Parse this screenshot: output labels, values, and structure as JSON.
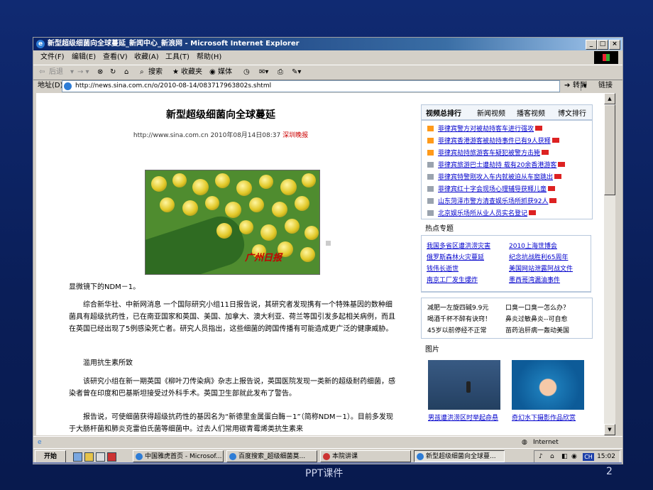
{
  "window": {
    "title": "新型超级细菌向全球蔓延_新闻中心_新浪网 - Microsoft Internet Explorer",
    "min_label": "_",
    "max_label": "□",
    "close_label": "×"
  },
  "menu": [
    "文件(F)",
    "编辑(E)",
    "查看(V)",
    "收藏(A)",
    "工具(T)",
    "帮助(H)"
  ],
  "toolbar": {
    "back": "后退",
    "search": "搜索",
    "favorites": "收藏夹",
    "media": "媒体"
  },
  "address": {
    "label": "地址(D)",
    "url": "http://news.sina.com.cn/o/2010-08-14/083717963802s.shtml",
    "go": "转到",
    "links": "链接"
  },
  "article": {
    "headline": "新型超级细菌向全球蔓延",
    "byline_main": "http://www.sina.com.cn  2010年08月14日08:37",
    "byline_source": "深圳晚报",
    "photo_watermark": "广州日报",
    "caption": "显微镜下的NDM－1。",
    "paragraphs": [
      "综合新华社、中新网消息 一个国际研究小组11日报告说，其研究者发现携有一个特殊基因的数种细菌具有超级抗药性，已在南亚国家和英国、美国、加拿大、澳大利亚、荷兰等国引发多起相关病例，而且在英国已经出现了5例感染死亡者。研究人员指出，这些细菌的跨国传播有可能造成更广泛的健康威胁。",
      "滥用抗生素所致",
      "该研究小组在新一期英国《柳叶刀传染病》杂志上报告说，英国医院发现一类新的超级耐药细菌，感染者曾在印度和巴基斯坦接受过外科手术。英国卫生部就此发布了警告。",
      "报告说，可使细菌获得超级抗药性的基因名为“新德里金属蛋白酶－1”（简称NDM－1）。目前多发现于大肠杆菌和肺炎克雷伯氏菌等细菌中。过去人们常用碳青霉烯类抗生素来"
    ]
  },
  "sidebar": {
    "tabs": [
      "视频总排行",
      "新闻视频",
      "播客视频",
      "博文排行"
    ],
    "rank": [
      "菲律宾警方对被劫持客车进行强攻",
      "菲律宾香港游客被劫持事件已有9人获释",
      "菲律宾劫持旅游客车疑犯被警方击毙",
      "菲律宾旅游巴士遭劫持 载有20余香港游客",
      "菲律宾特警刚攻入车内就被迫从车窗跳出",
      "菲律宾红十字会现场心理辅导获释儿童",
      "山东菏泽市警方清查娱乐场所抓获92人",
      "北京娱乐场所从业人员实名登记"
    ],
    "hot_title": "热点专题",
    "hot_left": [
      "我国多省区遭洪涝灾害",
      "俄罗斯森林火灾蔓延",
      "钱伟长逝世",
      "南京工厂发生爆炸"
    ],
    "hot_right": [
      "2010上海世博会",
      "纪念抗战胜利65周年",
      "美国网站泄露阿战文件",
      "墨西哥湾漏油事件"
    ],
    "ads": [
      [
        "减肥一左旋四碱9.9元",
        "口臭一口臭一怎么办？"
      ],
      [
        "喝酒千杯不醉有诀窍！",
        "鼻炎过敏鼻炎--可自愈"
      ],
      [
        "45岁以前停经不正常",
        "苗药治肝病一轰动美国"
      ]
    ],
    "photos_title": "图片",
    "photo_captions": [
      "男孩遭洪涝区时举起命悬",
      "奇幻水下摄影作品欣赏"
    ]
  },
  "status": {
    "zone": "Internet"
  },
  "taskbar": {
    "start": "开始",
    "tasks": [
      "中国雅虎首页 - Microsof...",
      "百度搜索_超级细菌莫...",
      "本院讲课",
      "新型超级细菌向全球蔓..."
    ],
    "lang": "CH",
    "clock": "15:02"
  },
  "slide": {
    "footer": "PPT课件",
    "page": "2"
  }
}
